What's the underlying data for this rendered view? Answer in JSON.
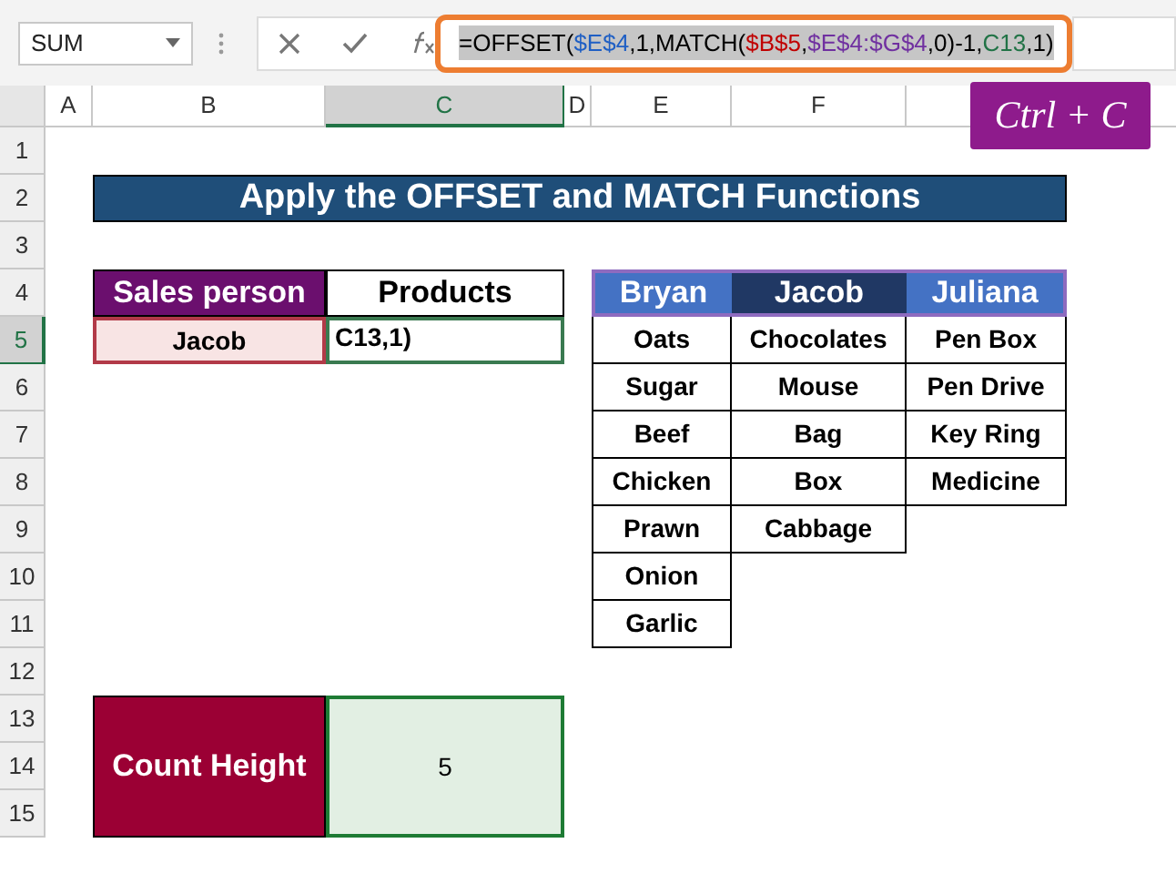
{
  "name_box": {
    "value": "SUM"
  },
  "formula_bar": {
    "parts": [
      {
        "text": "=OFFSET(",
        "reference": "$E$4",
        "color": "#1f5fc4"
      },
      {
        "text": ",1,MATCH(",
        "reference": "$B$5",
        "color": "#c00000"
      },
      {
        "text": ",",
        "reference": "$E$4:$G$4",
        "color": "#7030a0"
      },
      {
        "text": ",0)-1,",
        "reference": "C13",
        "color": "#217346"
      }
    ],
    "tail": ",1)"
  },
  "shortcut_badge": "Ctrl + C",
  "columns": [
    {
      "label": "A",
      "selected": false
    },
    {
      "label": "B",
      "selected": false
    },
    {
      "label": "C",
      "selected": true
    },
    {
      "label": "D",
      "selected": false
    },
    {
      "label": "E",
      "selected": false
    },
    {
      "label": "F",
      "selected": false
    }
  ],
  "rows": [
    {
      "label": "1",
      "selected": false
    },
    {
      "label": "2",
      "selected": false
    },
    {
      "label": "3",
      "selected": false
    },
    {
      "label": "4",
      "selected": false
    },
    {
      "label": "5",
      "selected": true
    },
    {
      "label": "6",
      "selected": false
    },
    {
      "label": "7",
      "selected": false
    },
    {
      "label": "8",
      "selected": false
    },
    {
      "label": "9",
      "selected": false
    },
    {
      "label": "10",
      "selected": false
    },
    {
      "label": "11",
      "selected": false
    },
    {
      "label": "12",
      "selected": false
    },
    {
      "label": "13",
      "selected": false
    },
    {
      "label": "14",
      "selected": false
    },
    {
      "label": "15",
      "selected": false
    }
  ],
  "title": "Apply the OFFSET and MATCH Functions",
  "input_table": {
    "headers": [
      "Sales person",
      "Products"
    ],
    "sales_person": "Jacob",
    "products": "C13,1)"
  },
  "lookup_table": {
    "columns": [
      {
        "header": "Bryan",
        "selected": false,
        "items": [
          "Oats",
          "Sugar",
          "Beef",
          "Chicken",
          "Prawn",
          "Onion",
          "Garlic"
        ]
      },
      {
        "header": "Jacob",
        "selected": true,
        "items": [
          "Chocolates",
          "Mouse",
          "Bag",
          "Box",
          "Cabbage"
        ]
      },
      {
        "header": "Juliana",
        "selected": false,
        "items": [
          "Pen Box",
          "Pen Drive",
          "Key Ring",
          "Medicine"
        ]
      }
    ]
  },
  "count_height": {
    "label": "Count Height",
    "value": "5"
  }
}
